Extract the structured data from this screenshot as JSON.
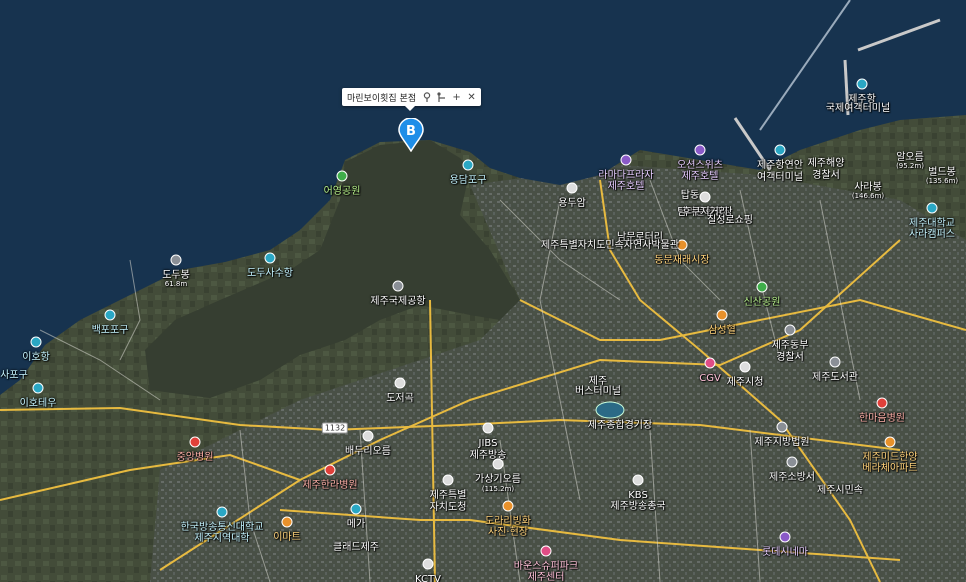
{
  "popup": {
    "title": "마린보이횟집 본점",
    "icons": [
      "pin-icon",
      "route-icon",
      "add-icon",
      "close-icon"
    ]
  },
  "marker": {
    "letter": "B",
    "color": "#1e8ee8"
  },
  "road_shield": "1132",
  "colors": {
    "sea": "#17334f",
    "land": "#47503f",
    "highlight": "#363e31",
    "road": "#f0c040"
  },
  "labels": [
    {
      "text": "어영공원",
      "cls": "green",
      "icon": "green",
      "name": "label-eoyeong-park"
    },
    {
      "text": "용담포구",
      "cls": "cyan",
      "icon": "teal",
      "name": "label-yongdam-port"
    },
    {
      "text": "용두암",
      "cls": "",
      "icon": "white",
      "name": "label-yongduam"
    },
    {
      "text": "도두봉",
      "cls": "",
      "icon": "gray",
      "name": "label-dodubong"
    },
    {
      "text": "61.8m",
      "cls": "sm",
      "icon": "",
      "name": "label-dodubong-height"
    },
    {
      "text": "도두사수항",
      "cls": "cyan",
      "icon": "teal",
      "name": "label-dodu-sasu-port"
    },
    {
      "text": "백포포구",
      "cls": "cyan",
      "icon": "teal",
      "name": "label-baekpo-port"
    },
    {
      "text": "이호항",
      "cls": "cyan",
      "icon": "teal",
      "name": "label-iho-port"
    },
    {
      "text": "사포구",
      "cls": "cyan",
      "icon": "",
      "name": "label-sapo-port"
    },
    {
      "text": "이호테우",
      "cls": "cyan",
      "icon": "teal",
      "name": "label-iho-teu"
    },
    {
      "text": "제주국제공항",
      "cls": "",
      "icon": "gray",
      "name": "label-jeju-airport"
    },
    {
      "text": "도저곡",
      "cls": "",
      "icon": "white",
      "name": "label-dojeogok"
    },
    {
      "text": "제주항",
      "cls": "",
      "icon": "teal",
      "name": "label-jeju-port"
    },
    {
      "text": "국제여객터미널",
      "cls": "",
      "icon": "",
      "name": "label-intl-passenger-terminal"
    },
    {
      "text": "제주항연안",
      "cls": "",
      "icon": "teal",
      "name": "label-jeju-coastal"
    },
    {
      "text": "여객터미널",
      "cls": "",
      "icon": "",
      "name": "label-coastal-terminal"
    },
    {
      "text": "제주해양",
      "cls": "",
      "icon": "",
      "name": "label-jeju-marine"
    },
    {
      "text": "경찰서",
      "cls": "",
      "icon": "",
      "name": "label-marine-police"
    },
    {
      "text": "오션스위츠",
      "cls": "lav",
      "icon": "purple",
      "name": "label-ocean-suites"
    },
    {
      "text": "제주호텔",
      "cls": "lav",
      "icon": "",
      "name": "label-ocean-suites-hotel"
    },
    {
      "text": "라마다프라자",
      "cls": "lav",
      "icon": "purple",
      "name": "label-ramada-plaza"
    },
    {
      "text": "제주호텔",
      "cls": "lav",
      "icon": "",
      "name": "label-ramada-hotel"
    },
    {
      "text": "탑동",
      "cls": "",
      "icon": "",
      "name": "label-tapdong"
    },
    {
      "text": "탐라문화광장",
      "cls": "",
      "icon": "",
      "name": "label-tamna-plaza"
    },
    {
      "text": "사라봉",
      "cls": "",
      "icon": "",
      "name": "label-sarabong"
    },
    {
      "text": "(146.6m)",
      "cls": "sm",
      "icon": "",
      "name": "label-sarabong-height"
    },
    {
      "text": "벌드봉",
      "cls": "",
      "icon": "",
      "name": "label-byeoldobong"
    },
    {
      "text": "(135.6m)",
      "cls": "sm",
      "icon": "",
      "name": "label-byeoldobong-height"
    },
    {
      "text": "알오름",
      "cls": "",
      "icon": "",
      "name": "label-aloreum"
    },
    {
      "text": "(95.2m)",
      "cls": "sm",
      "icon": "",
      "name": "label-aloreum-height"
    },
    {
      "text": "제주대학교",
      "cls": "cyan",
      "icon": "teal",
      "name": "label-jeju-univ"
    },
    {
      "text": "사라캠퍼스",
      "cls": "cyan",
      "icon": "",
      "name": "label-sara-campus"
    },
    {
      "text": "후쿠지거리",
      "cls": "",
      "icon": "white",
      "name": "label-hukuji-street"
    },
    {
      "text": "칠성로쇼핑",
      "cls": "",
      "icon": "",
      "name": "label-chilseong"
    },
    {
      "text": "동문재래시장",
      "cls": "orange",
      "icon": "orange",
      "name": "label-dongmun-market"
    },
    {
      "text": "남문로터리",
      "cls": "",
      "icon": "",
      "name": "label-nammun-rotary"
    },
    {
      "text": "제주특별자치도민속자연사박물관",
      "cls": "",
      "icon": "",
      "name": "label-folk-museum"
    },
    {
      "text": "신산공원",
      "cls": "green",
      "icon": "green",
      "name": "label-sinsan-park"
    },
    {
      "text": "삼성혈",
      "cls": "orange",
      "icon": "orange",
      "name": "label-samseonghyeol"
    },
    {
      "text": "제주동부",
      "cls": "",
      "icon": "gray",
      "name": "label-jeju-east"
    },
    {
      "text": "경찰서",
      "cls": "",
      "icon": "",
      "name": "label-east-police"
    },
    {
      "text": "제주시청",
      "cls": "",
      "icon": "white",
      "name": "label-jeju-city-hall"
    },
    {
      "text": "CGV",
      "cls": "pink",
      "icon": "pink",
      "name": "label-cgv"
    },
    {
      "text": "제주도서관",
      "cls": "",
      "icon": "gray",
      "name": "label-jeju-library"
    },
    {
      "text": "한마음병원",
      "cls": "red",
      "icon": "red",
      "name": "label-hanmaum-hospital"
    },
    {
      "text": "제주지방법원",
      "cls": "",
      "icon": "gray",
      "name": "label-district-court"
    },
    {
      "text": "제주소방서",
      "cls": "",
      "icon": "gray",
      "name": "label-fire-station"
    },
    {
      "text": "제주시민속",
      "cls": "",
      "icon": "",
      "name": "label-jeju-folk"
    },
    {
      "text": "제주미드한양",
      "cls": "orange",
      "icon": "orange",
      "name": "label-hanyang-1"
    },
    {
      "text": "베라체아파트",
      "cls": "orange",
      "icon": "",
      "name": "label-hanyang-2"
    },
    {
      "text": "제주",
      "cls": "",
      "icon": "",
      "name": "label-jeju-small"
    },
    {
      "text": "버스터미널",
      "cls": "",
      "icon": "",
      "name": "label-bus-terminal"
    },
    {
      "text": "제주종합경기장",
      "cls": "",
      "icon": "",
      "name": "label-stadium"
    },
    {
      "text": "JIBS",
      "cls": "",
      "icon": "white",
      "name": "label-jibs"
    },
    {
      "text": "제주방송",
      "cls": "",
      "icon": "",
      "name": "label-jibs-broadcast"
    },
    {
      "text": "KBS",
      "cls": "",
      "icon": "white",
      "name": "label-kbs"
    },
    {
      "text": "제주방송총국",
      "cls": "",
      "icon": "",
      "name": "label-kbs-jeju"
    },
    {
      "text": "배두리오름",
      "cls": "",
      "icon": "white",
      "name": "label-baeduri-oreum"
    },
    {
      "text": "중앙병원",
      "cls": "red",
      "icon": "red",
      "name": "label-jungang-hospital"
    },
    {
      "text": "제주한라병원",
      "cls": "red",
      "icon": "red",
      "name": "label-halla-hospital"
    },
    {
      "text": "가상기오름",
      "cls": "",
      "icon": "white",
      "name": "label-gasanggi-oreum"
    },
    {
      "text": "(115.2m)",
      "cls": "sm",
      "icon": "",
      "name": "label-gasanggi-height"
    },
    {
      "text": "제주특별",
      "cls": "",
      "icon": "white",
      "name": "label-jeju-special"
    },
    {
      "text": "자치도청",
      "cls": "",
      "icon": "",
      "name": "label-provincial-office"
    },
    {
      "text": "도라리빙화",
      "cls": "orange",
      "icon": "orange",
      "name": "label-dorari"
    },
    {
      "text": "사진·현장",
      "cls": "orange",
      "icon": "",
      "name": "label-photo-site"
    },
    {
      "text": "이마트",
      "cls": "orange",
      "icon": "orange",
      "name": "label-emart"
    },
    {
      "text": "한국방송통신대학교",
      "cls": "cyan",
      "icon": "teal",
      "name": "label-knou"
    },
    {
      "text": "제주지역대학",
      "cls": "cyan",
      "icon": "",
      "name": "label-knou-jeju"
    },
    {
      "text": "메가",
      "cls": "",
      "icon": "teal",
      "name": "label-mega"
    },
    {
      "text": "클래드제주",
      "cls": "",
      "icon": "",
      "name": "label-clade-jeju"
    },
    {
      "text": "KCTV",
      "cls": "",
      "icon": "white",
      "name": "label-kctv"
    },
    {
      "text": "바운스슈퍼파크",
      "cls": "pink",
      "icon": "pink",
      "name": "label-bounce-superpark"
    },
    {
      "text": "제주센터",
      "cls": "pink",
      "icon": "",
      "name": "label-bounce-jeju"
    },
    {
      "text": "롯데시네마",
      "cls": "lav",
      "icon": "purple",
      "name": "label-lotte-cinema"
    }
  ]
}
